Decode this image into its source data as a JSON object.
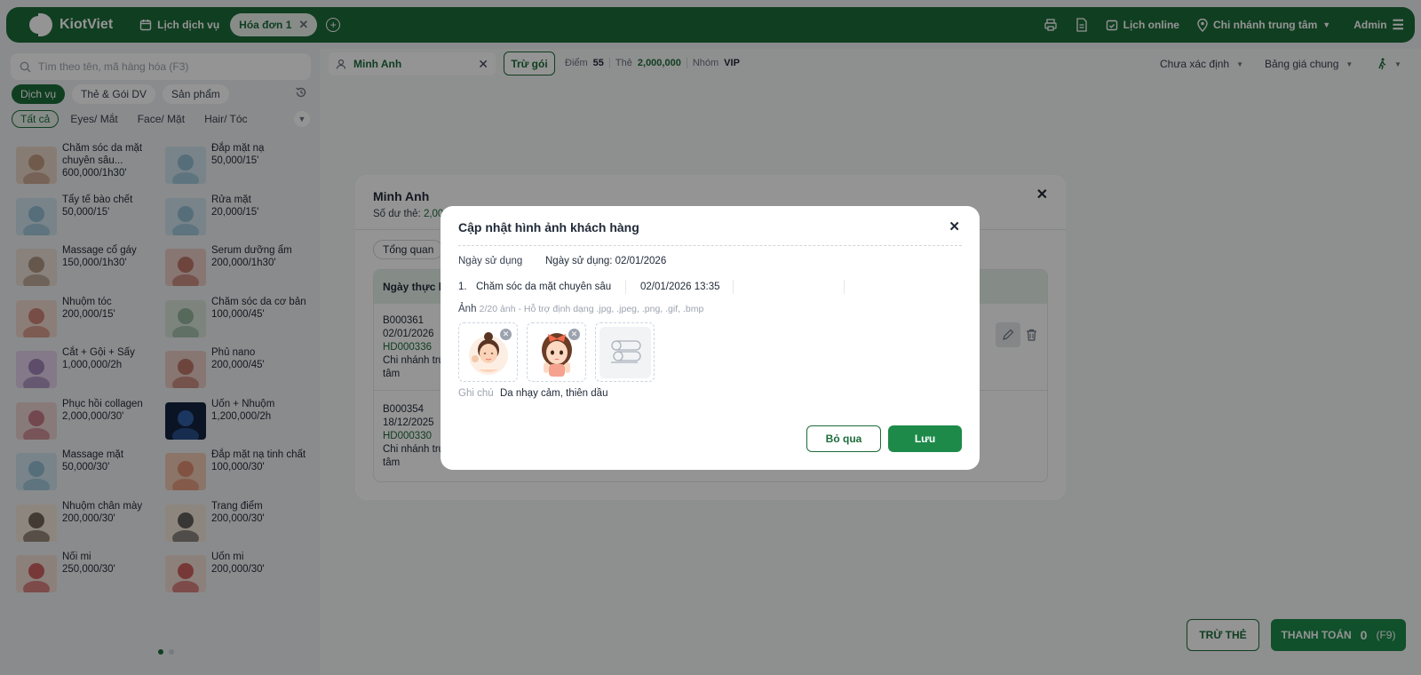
{
  "topbar": {
    "brand": "KiotViet",
    "nav_services": "Lịch dịch vụ",
    "tab_active": "Hóa đơn 1",
    "online": "Lịch online",
    "branch": "Chi nhánh trung tâm",
    "user": "Admin"
  },
  "left": {
    "search_placeholder": "Tìm theo tên, mã hàng hóa (F3)",
    "categories": [
      "Dịch vụ",
      "Thẻ & Gói DV",
      "Sản phẩm"
    ],
    "subcategories": [
      "Tất cả",
      "Eyes/ Mắt",
      "Face/ Mặt",
      "Hair/ Tóc"
    ],
    "items": [
      {
        "name": "Chăm sóc da mặt chuyên sâu...",
        "price": "600,000/1h30'"
      },
      {
        "name": "Đắp mặt nạ",
        "price": "50,000/15'"
      },
      {
        "name": "Tẩy tế bào chết",
        "price": "50,000/15'"
      },
      {
        "name": "Rửa mặt",
        "price": "20,000/15'"
      },
      {
        "name": "Massage cổ gáy",
        "price": "150,000/1h30'"
      },
      {
        "name": "Serum dưỡng ẩm",
        "price": "200,000/1h30'"
      },
      {
        "name": "Nhuộm tóc",
        "price": "200,000/15'"
      },
      {
        "name": "Chăm sóc da cơ bản",
        "price": "100,000/45'"
      },
      {
        "name": "Cắt + Gội + Sấy",
        "price": "1,000,000/2h"
      },
      {
        "name": "Phủ nano",
        "price": "200,000/45'"
      },
      {
        "name": "Phục hồi collagen",
        "price": "2,000,000/30'"
      },
      {
        "name": "Uốn + Nhuộm",
        "price": "1,200,000/2h"
      },
      {
        "name": "Massage mặt",
        "price": "50,000/30'"
      },
      {
        "name": "Đắp mặt nạ tinh chất",
        "price": "100,000/30'"
      },
      {
        "name": "Nhuộm chân mày",
        "price": "200,000/30'"
      },
      {
        "name": "Trang điểm",
        "price": "200,000/30'"
      },
      {
        "name": "Nối mi",
        "price": "250,000/30'"
      },
      {
        "name": "Uốn mi",
        "price": "200,000/30'"
      }
    ]
  },
  "main": {
    "customer": "Minh Anh",
    "tru_goi": "Trừ gói",
    "points_label": "Điểm",
    "points": "55",
    "card_label": "Thẻ",
    "card": "2,000,000",
    "group_label": "Nhóm",
    "group": "VIP",
    "status": "Chưa xác định",
    "pricebook": "Bảng giá chung",
    "btn_tru_the": "TRỪ THẺ",
    "btn_pay": "THANH TOÁN",
    "pay_amount": "0",
    "pay_key": "(F9)"
  },
  "card": {
    "title": "Minh Anh",
    "balance_label": "Số dư thẻ:",
    "balance": "2,00",
    "tab": "Tổng quan",
    "col": "Ngày thực hi",
    "rows": [
      {
        "code": "B000361",
        "date": "02/01/2026",
        "inv": "HD000336",
        "branch1": "Chi nhánh tru",
        "branch2": "tâm"
      },
      {
        "code": "B000354",
        "date": "18/12/2025",
        "inv": "HD000330",
        "branch1": "Chi nhánh tru",
        "branch2": "tâm"
      }
    ]
  },
  "modal": {
    "title": "Cập nhật hình ảnh khách hàng",
    "use_date_label": "Ngày sử dụng",
    "use_date_value": "Ngày sử dụng: 02/01/2026",
    "item_no": "1.",
    "item_name": "Chăm sóc da mặt chuyên sâu",
    "item_time": "02/01/2026 13:35",
    "photo_label": "Ảnh",
    "photo_hint": "2/20 ảnh - Hỗ trợ định dạng .jpg, .jpeg, .png, .gif, .bmp",
    "note_label": "Ghi chú",
    "note_value": "Da nhạy cảm, thiên dầu",
    "cancel": "Bỏ qua",
    "save": "Lưu"
  }
}
